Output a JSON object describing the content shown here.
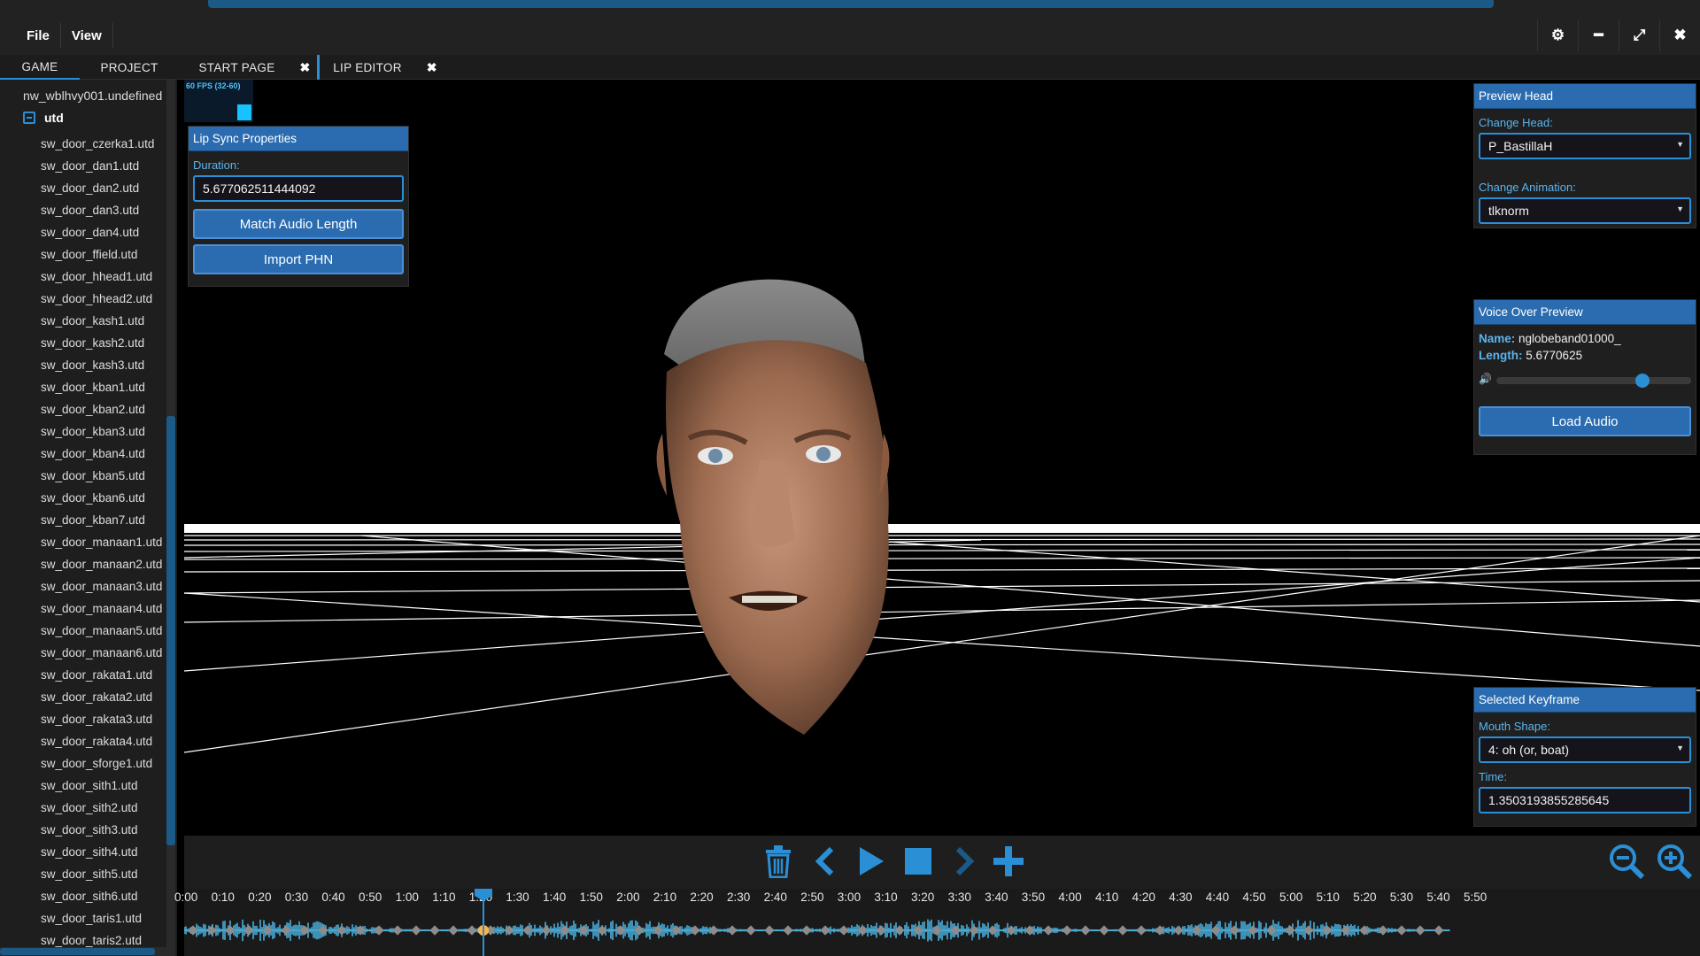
{
  "menu": {
    "file": "File",
    "view": "View"
  },
  "window_controls": {
    "settings": "⚙",
    "minimize": "━",
    "maximize": "⤢",
    "close": "✖"
  },
  "tabs": {
    "left": [
      {
        "label": "GAME"
      },
      {
        "label": "PROJECT"
      }
    ],
    "main": [
      {
        "label": "START PAGE",
        "close": "✖"
      },
      {
        "label": "LIP EDITOR",
        "close": "✖"
      }
    ]
  },
  "tree": {
    "root": "nw_wblhvy001.undefined",
    "folder": "utd",
    "items": [
      "sw_door_czerka1.utd",
      "sw_door_dan1.utd",
      "sw_door_dan2.utd",
      "sw_door_dan3.utd",
      "sw_door_dan4.utd",
      "sw_door_ffield.utd",
      "sw_door_hhead1.utd",
      "sw_door_hhead2.utd",
      "sw_door_kash1.utd",
      "sw_door_kash2.utd",
      "sw_door_kash3.utd",
      "sw_door_kban1.utd",
      "sw_door_kban2.utd",
      "sw_door_kban3.utd",
      "sw_door_kban4.utd",
      "sw_door_kban5.utd",
      "sw_door_kban6.utd",
      "sw_door_kban7.utd",
      "sw_door_manaan1.utd",
      "sw_door_manaan2.utd",
      "sw_door_manaan3.utd",
      "sw_door_manaan4.utd",
      "sw_door_manaan5.utd",
      "sw_door_manaan6.utd",
      "sw_door_rakata1.utd",
      "sw_door_rakata2.utd",
      "sw_door_rakata3.utd",
      "sw_door_rakata4.utd",
      "sw_door_sforge1.utd",
      "sw_door_sith1.utd",
      "sw_door_sith2.utd",
      "sw_door_sith3.utd",
      "sw_door_sith4.utd",
      "sw_door_sith5.utd",
      "sw_door_sith6.utd",
      "sw_door_taris1.utd",
      "sw_door_taris2.utd"
    ]
  },
  "fps": {
    "label": "60 FPS (32-60)"
  },
  "lip_sync": {
    "title": "Lip Sync Properties",
    "duration_label": "Duration:",
    "duration_value": "5.677062511444092",
    "match_audio": "Match Audio Length",
    "import_phn": "Import PHN"
  },
  "preview_head": {
    "title": "Preview Head",
    "change_head_label": "Change Head:",
    "head_value": "P_BastillaH",
    "change_anim_label": "Change Animation:",
    "anim_value": "tlknorm"
  },
  "voice_over": {
    "title": "Voice Over Preview",
    "name_label": "Name:",
    "name_value": "nglobeband01000_",
    "length_label": "Length:",
    "length_value": "5.6770625",
    "volume": 0.75,
    "load_audio": "Load Audio"
  },
  "keyframe": {
    "title": "Selected Keyframe",
    "mouth_label": "Mouth Shape:",
    "mouth_value": "4: oh (or, boat)",
    "time_label": "Time:",
    "time_value": "1.3503193855285645"
  },
  "timeline": {
    "ticks": [
      "0:00",
      "0:10",
      "0:20",
      "0:30",
      "0:40",
      "0:50",
      "1:00",
      "1:10",
      "1:20",
      "1:30",
      "1:40",
      "1:50",
      "2:00",
      "2:10",
      "2:20",
      "2:30",
      "2:40",
      "2:50",
      "3:00",
      "3:10",
      "3:20",
      "3:30",
      "3:40",
      "3:50",
      "4:00",
      "4:10",
      "4:20",
      "4:30",
      "4:40",
      "4:50",
      "5:00",
      "5:10",
      "5:20",
      "5:30",
      "5:40",
      "5:50"
    ]
  },
  "colors": {
    "accent": "#2b8fd6",
    "panel_header": "#2b6cb0",
    "waveform": "#4fc3f7"
  }
}
